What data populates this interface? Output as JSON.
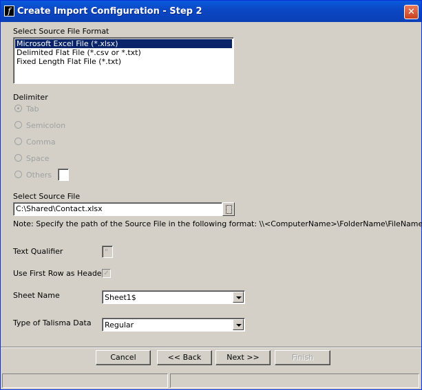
{
  "window": {
    "title": "Create Import Configuration - Step 2",
    "close_label": "✕"
  },
  "format": {
    "label": "Select Source File Format",
    "options": [
      "Microsoft Excel File (*.xlsx)",
      "Delimited Flat File (*.csv or *.txt)",
      "Fixed Length Flat File (*.txt)"
    ],
    "selected_index": 0
  },
  "delimiter": {
    "label": "Delimiter",
    "options": [
      "Tab",
      "Semicolon",
      "Comma",
      "Space",
      "Others"
    ],
    "selected": "Tab",
    "others_value": ""
  },
  "source_file": {
    "label": "Select Source File",
    "value": "C:\\Shared\\Contact.xlsx",
    "note": "Note: Specify the path of the Source File in the following format: \\\\<ComputerName>\\FolderName\\FileName."
  },
  "text_qualifier": {
    "label": "Text Qualifier",
    "value": "\""
  },
  "first_row": {
    "label": "Use First Row as Header",
    "checked": true
  },
  "sheet_name": {
    "label": "Sheet Name",
    "value": "Sheet1$"
  },
  "data_type": {
    "label": "Type of Talisma Data",
    "value": "Regular"
  },
  "buttons": {
    "cancel": "Cancel",
    "back": "<< Back",
    "next": "Next >>",
    "finish": "Finish"
  },
  "status": {
    "pane1": "",
    "pane2": ""
  }
}
